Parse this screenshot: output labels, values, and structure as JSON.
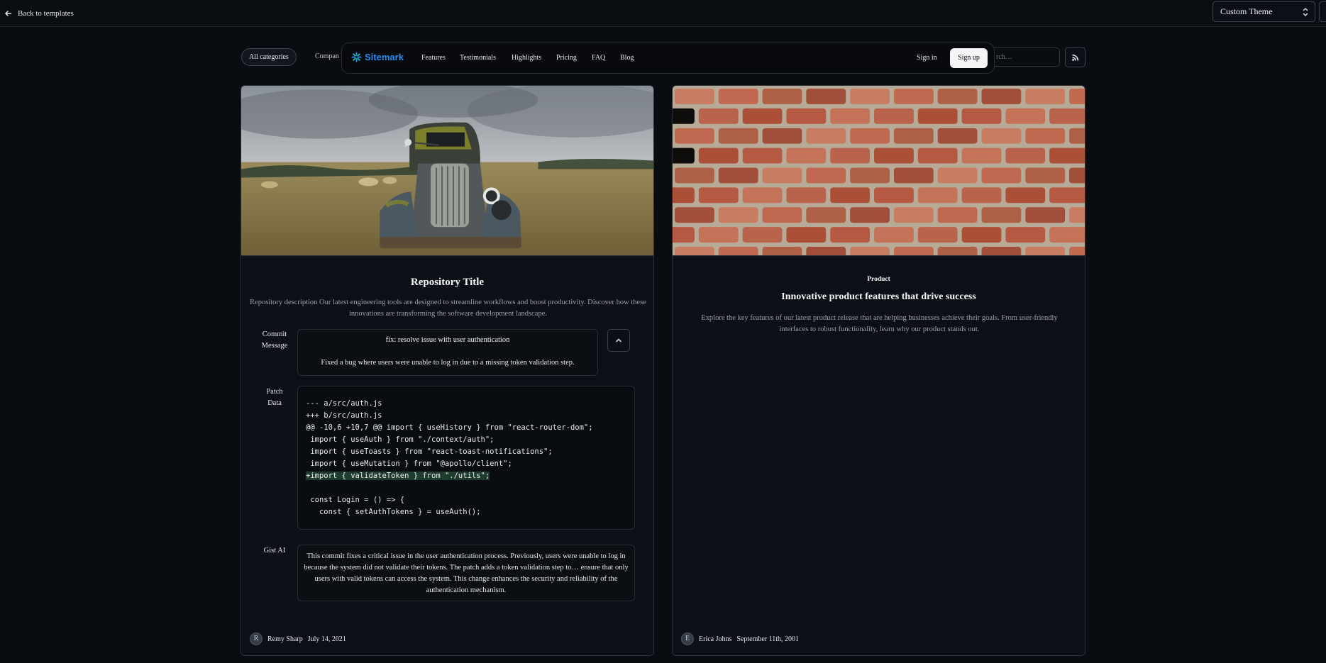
{
  "topbar": {
    "back_label": "Back to templates",
    "theme_select_value": "Custom Theme"
  },
  "filters": {
    "all_categories": "All categories",
    "partial_category": "Compan",
    "search_placeholder": "Search…",
    "search_visible_text": "rch…"
  },
  "nav": {
    "brand": "Sitemark",
    "items": [
      "Features",
      "Testimonials",
      "Highlights",
      "Pricing",
      "FAQ",
      "Blog"
    ],
    "sign_in": "Sign in",
    "sign_up": "Sign up"
  },
  "left_card": {
    "image_icon": "vintage-truck-photo",
    "title": "Repository Title",
    "description": "Repository description Our latest engineering tools are designed to streamline workflows and boost productivity. Discover how these innovations are transforming the software development landscape.",
    "commit_label_1": "Commit",
    "commit_label_2": "Message",
    "commit_title": "fix: resolve issue with user authentication",
    "commit_body": "Fixed a bug where users were unable to log in due to a missing token validation step.",
    "patch_label_1": "Patch",
    "patch_label_2": "Data",
    "patch_lines": [
      "--- a/src/auth.js",
      "+++ b/src/auth.js",
      "@@ -10,6 +10,7 @@ import { useHistory } from \"react-router-dom\";",
      " import { useAuth } from \"./context/auth\";",
      " import { useToasts } from \"react-toast-notifications\";",
      " import { useMutation } from \"@apollo/client\";",
      "+import { validateToken } from \"./utils\";",
      "",
      " const Login = () => {",
      "   const { setAuthTokens } = useAuth();"
    ],
    "gist_label": "Gist AI",
    "gist_text": "This commit fixes a critical issue in the user authentication process. Previously, users were unable to log in because the system did not validate their tokens. The patch adds a token validation step to… ensure that only users with valid tokens can access the system. This change enhances the security and reliability of the authentication mechanism.",
    "author_initial": "R",
    "author_name": "Remy Sharp",
    "date": "July 14, 2021"
  },
  "right_card": {
    "image_icon": "brick-wall-photo",
    "tag": "Product",
    "title": "Innovative product features that drive success",
    "description": "Explore the key features of our latest product release that are helping businesses achieve their goals. From user-friendly interfaces to robust functionality, learn why our product stands out.",
    "author_initial": "E",
    "author_name": "Erica Johns",
    "date": "September 11th, 2001"
  },
  "colors": {
    "background": "#090c11",
    "brand_blue": "#2d8cf0",
    "card_bg": "#0c1016",
    "border": "#2a313c",
    "diff_added_bg": "#1f3b2e"
  }
}
